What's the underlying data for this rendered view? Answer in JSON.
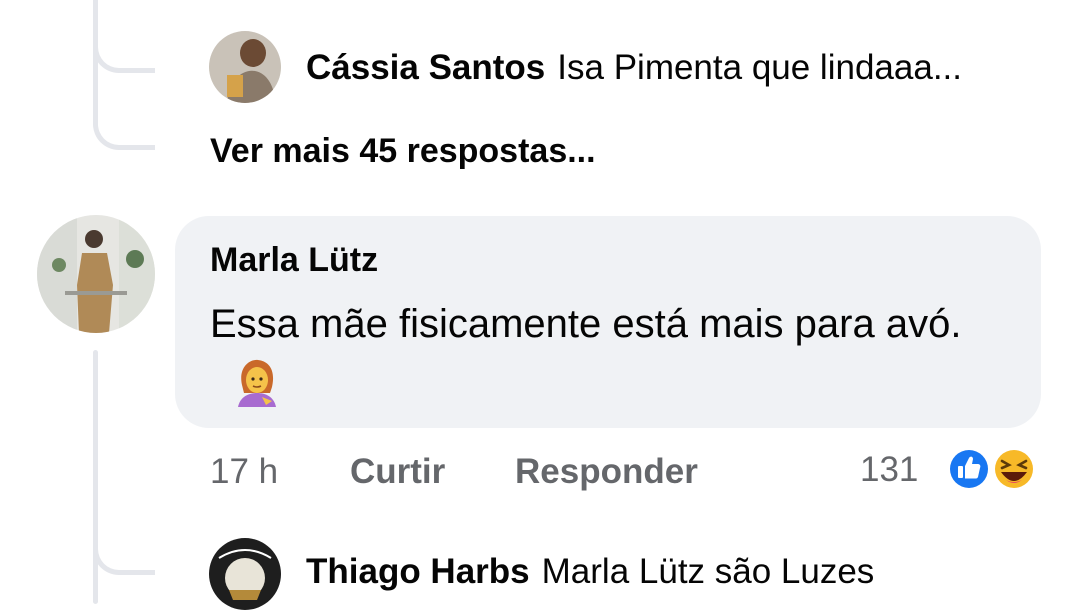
{
  "replies_top": {
    "reply": {
      "author": "Cássia Santos",
      "text": "Isa Pimenta que lindaaa..."
    },
    "more_replies": "Ver mais 45 respostas..."
  },
  "comment": {
    "author": "Marla Lütz",
    "text": "Essa mãe fisicamente está mais para avó.",
    "emoji_icon": "woman-gesturing-emoji-icon",
    "time": "17 h",
    "like_label": "Curtir",
    "reply_label": "Responder",
    "reaction_count": "131",
    "reaction_icons": [
      "like-reaction-icon",
      "haha-reaction-icon"
    ]
  },
  "reply_bottom": {
    "author": "Thiago Harbs",
    "text": "Marla Lütz são Luzes"
  },
  "colors": {
    "bubble": "#f0f2f5",
    "thread_line": "#e4e6eb",
    "meta_text": "#65676b",
    "like_blue": "#1877f2",
    "haha_yellow": "#f7b928"
  }
}
